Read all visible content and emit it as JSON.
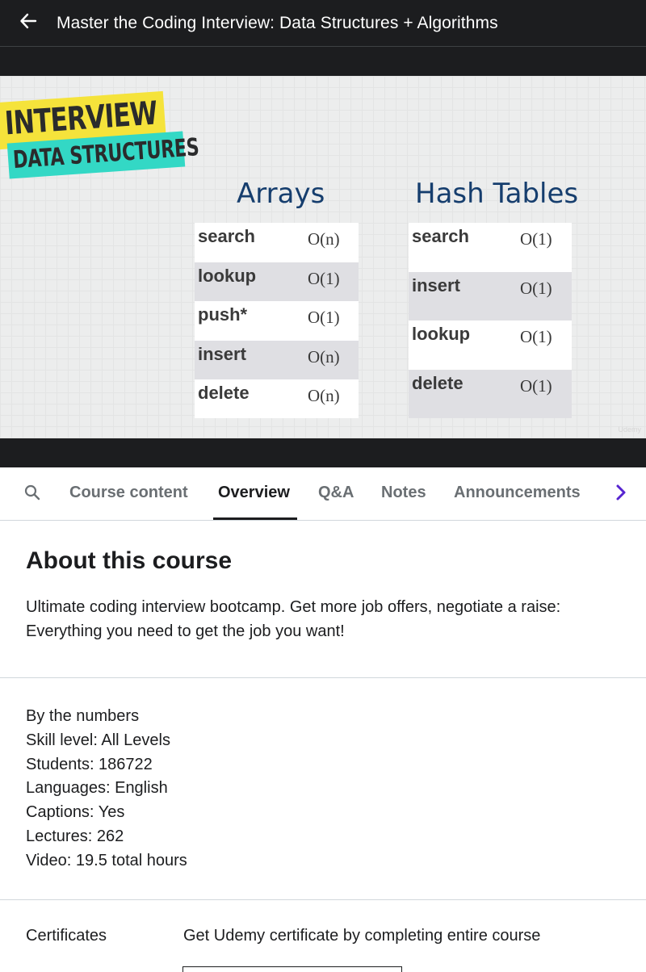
{
  "topbar": {
    "title": "Master the Coding Interview: Data Structures + Algorithms",
    "back_icon": "arrow-left-icon"
  },
  "slide": {
    "badge_interview": "INTERVIEW",
    "badge_data_structures": "DATA STRUCTURES",
    "arrays": {
      "title": "Arrays",
      "rows": [
        {
          "op": "search",
          "complexity": "O(n)"
        },
        {
          "op": "lookup",
          "complexity": "O(1)"
        },
        {
          "op": "push*",
          "complexity": "O(1)"
        },
        {
          "op": "insert",
          "complexity": "O(n)"
        },
        {
          "op": "delete",
          "complexity": "O(n)"
        }
      ]
    },
    "hash_tables": {
      "title": "Hash Tables",
      "rows": [
        {
          "op": "search",
          "complexity": "O(1)"
        },
        {
          "op": "insert",
          "complexity": "O(1)"
        },
        {
          "op": "lookup",
          "complexity": "O(1)"
        },
        {
          "op": "delete",
          "complexity": "O(1)"
        }
      ]
    },
    "watermark": "Udemy"
  },
  "tabs": {
    "search_icon": "search-icon",
    "items": [
      {
        "label": "Course content",
        "active": false
      },
      {
        "label": "Overview",
        "active": true
      },
      {
        "label": "Q&A",
        "active": false
      },
      {
        "label": "Notes",
        "active": false
      },
      {
        "label": "Announcements",
        "active": false
      }
    ],
    "next_icon": "chevron-right-icon"
  },
  "about": {
    "heading": "About this course",
    "description": "Ultimate coding interview bootcamp. Get more job offers, negotiate a raise: Everything you need to get the job you want!"
  },
  "numbers": {
    "heading": "By the numbers",
    "lines": [
      "Skill level: All Levels",
      "Students: 186722",
      "Languages: English",
      "Captions: Yes",
      "Lectures: 262",
      "Video: 19.5 total hours"
    ]
  },
  "certificates": {
    "label": "Certificates",
    "text": "Get Udemy certificate by completing entire course"
  },
  "colors": {
    "topbar_bg": "#1c1d1f",
    "accent_purple": "#5624d0",
    "badge_yellow": "#f5e33b",
    "badge_teal": "#33d8c5",
    "slide_title_blue": "#163e6e"
  }
}
